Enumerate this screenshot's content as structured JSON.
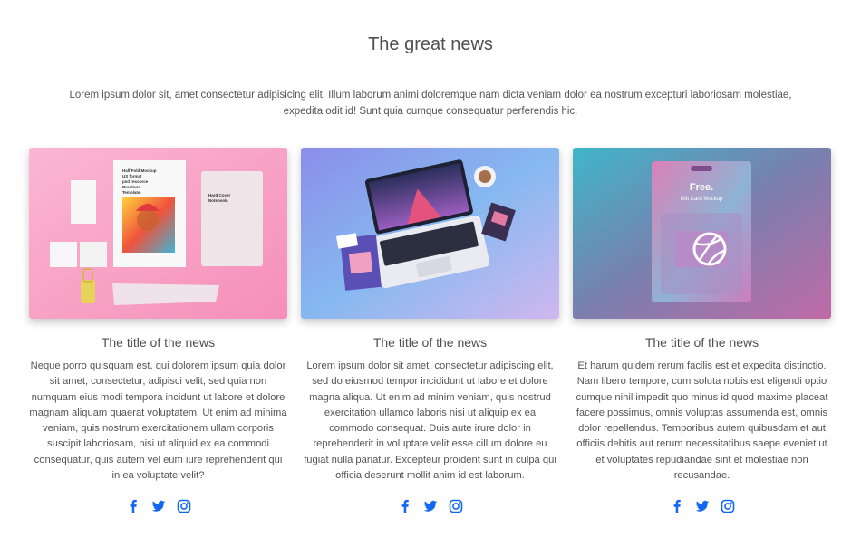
{
  "section": {
    "title": "The great news",
    "intro": "Lorem ipsum dolor sit, amet consectetur adipisicing elit. Illum laborum animi doloremque nam dicta veniam dolor ea nostrum excepturi laboriosam molestiae, expedita odit id! Sunt quia cumque consequatur perferendis hic."
  },
  "cards": [
    {
      "title": "The title of the news",
      "text": "Neque porro quisquam est, qui dolorem ipsum quia dolor sit amet, consectetur, adipisci velit, sed quia non numquam eius modi tempora incidunt ut labore et dolore magnam aliquam quaerat voluptatem. Ut enim ad minima veniam, quis nostrum exercitationem ullam corporis suscipit laboriosam, nisi ut aliquid ex ea commodi consequatur, quis autem vel eum iure reprehenderit qui in ea voluptate velit?",
      "image": {
        "brochure_lines": [
          "Half Fold Mockup",
          "US format",
          "psd resource",
          "Brochure",
          "Template."
        ],
        "notebook_lines": [
          "Hard Cover",
          "Notebook."
        ]
      }
    },
    {
      "title": "The title of the news",
      "text": "Lorem ipsum dolor sit amet, consectetur adipiscing elit, sed do eiusmod tempor incididunt ut labore et dolore magna aliqua. Ut enim ad minim veniam, quis nostrud exercitation ullamco laboris nisi ut aliquip ex ea commodo consequat. Duis aute irure dolor in reprehenderit in voluptate velit esse cillum dolore eu fugiat nulla pariatur. Excepteur proident sunt in culpa qui officia deserunt mollit anim id est laborum."
    },
    {
      "title": "The title of the news",
      "text": "Et harum quidem rerum facilis est et expedita distinctio. Nam libero tempore, cum soluta nobis est eligendi optio cumque nihil impedit quo minus id quod maxime placeat facere possimus, omnis voluptas assumenda est, omnis dolor repellendus. Temporibus autem quibusdam et aut officiis debitis aut rerum necessitatibus saepe eveniet ut et voluptates repudiandae sint et molestiae non recusandae.",
      "image": {
        "card_headline": "Free.",
        "card_subline": "Gift Card Mockup"
      }
    }
  ],
  "icons": [
    "facebook-icon",
    "twitter-icon",
    "instagram-icon"
  ],
  "colors": {
    "accent": "#1266f1",
    "text": "#4f4f4f"
  }
}
